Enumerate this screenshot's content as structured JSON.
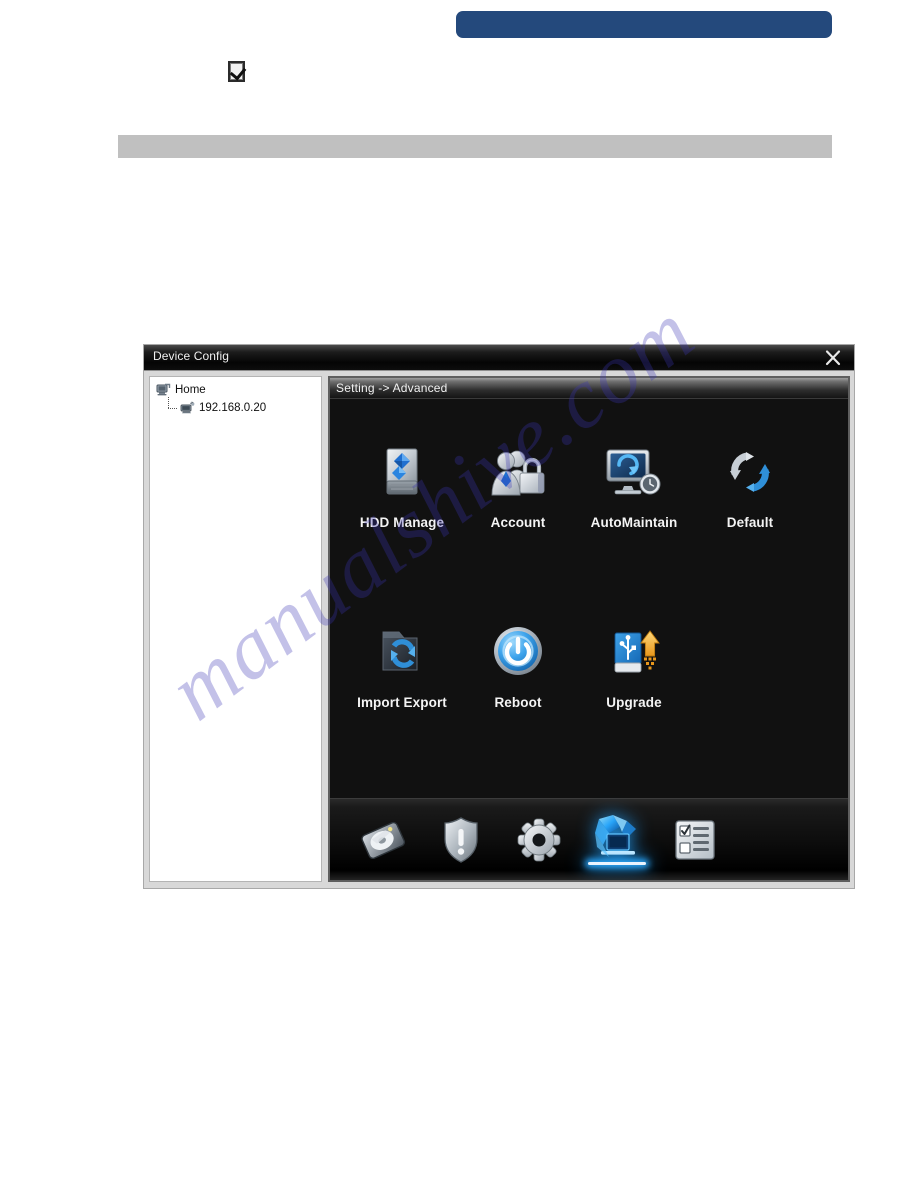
{
  "page": {
    "banner_text": "",
    "checkbox_state": "checked",
    "gray_band_text": "",
    "watermark": "manualshive.com"
  },
  "dialog": {
    "title": "Device Config",
    "close_label": "×",
    "close_icon": "close-icon"
  },
  "tree": {
    "nodes": [
      {
        "label": "Home",
        "icon": "computer-home-icon",
        "level": 0
      },
      {
        "label": "192.168.0.20",
        "icon": "device-nvr-icon",
        "level": 1
      }
    ]
  },
  "content": {
    "breadcrumb": "Setting -> Advanced",
    "menu_rows": [
      [
        {
          "label": "HDD Manage",
          "icon": "hdd-manage-icon"
        },
        {
          "label": "Account",
          "icon": "account-lock-icon"
        },
        {
          "label": "AutoMaintain",
          "icon": "automaintain-icon"
        },
        {
          "label": "Default",
          "icon": "default-restore-icon"
        }
      ],
      [
        {
          "label": "Import Export",
          "icon": "import-export-icon"
        },
        {
          "label": "Reboot",
          "icon": "reboot-power-icon"
        },
        {
          "label": "Upgrade",
          "icon": "upgrade-usb-icon"
        }
      ]
    ]
  },
  "toolbar": {
    "items": [
      {
        "name": "record-icon",
        "title": "Record",
        "active": false
      },
      {
        "name": "alarm-icon",
        "title": "Alarm",
        "active": false
      },
      {
        "name": "system-icon",
        "title": "System",
        "active": false
      },
      {
        "name": "advanced-icon",
        "title": "Advanced",
        "active": true
      },
      {
        "name": "info-icon",
        "title": "Info",
        "active": false
      }
    ]
  },
  "colors": {
    "banner_blue": "#24497c",
    "gray_band": "#c0c0c0",
    "panel_black": "#0a0a0a",
    "accent_blue": "#2aa9ff",
    "watermark": "#3b35b5"
  }
}
